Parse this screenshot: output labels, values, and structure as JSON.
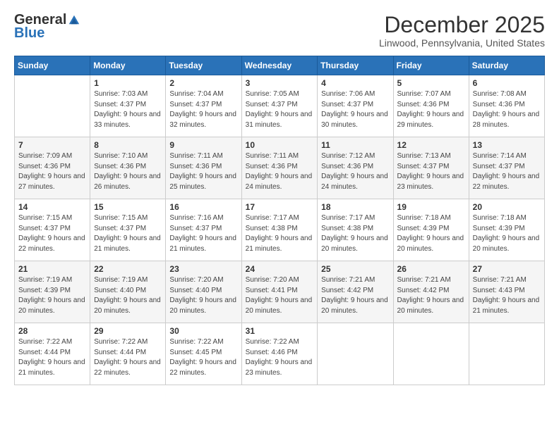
{
  "header": {
    "logo_general": "General",
    "logo_blue": "Blue",
    "month_title": "December 2025",
    "location": "Linwood, Pennsylvania, United States"
  },
  "days_of_week": [
    "Sunday",
    "Monday",
    "Tuesday",
    "Wednesday",
    "Thursday",
    "Friday",
    "Saturday"
  ],
  "weeks": [
    [
      {
        "day": "",
        "sunrise": "",
        "sunset": "",
        "daylight": ""
      },
      {
        "day": "1",
        "sunrise": "Sunrise: 7:03 AM",
        "sunset": "Sunset: 4:37 PM",
        "daylight": "Daylight: 9 hours and 33 minutes."
      },
      {
        "day": "2",
        "sunrise": "Sunrise: 7:04 AM",
        "sunset": "Sunset: 4:37 PM",
        "daylight": "Daylight: 9 hours and 32 minutes."
      },
      {
        "day": "3",
        "sunrise": "Sunrise: 7:05 AM",
        "sunset": "Sunset: 4:37 PM",
        "daylight": "Daylight: 9 hours and 31 minutes."
      },
      {
        "day": "4",
        "sunrise": "Sunrise: 7:06 AM",
        "sunset": "Sunset: 4:37 PM",
        "daylight": "Daylight: 9 hours and 30 minutes."
      },
      {
        "day": "5",
        "sunrise": "Sunrise: 7:07 AM",
        "sunset": "Sunset: 4:36 PM",
        "daylight": "Daylight: 9 hours and 29 minutes."
      },
      {
        "day": "6",
        "sunrise": "Sunrise: 7:08 AM",
        "sunset": "Sunset: 4:36 PM",
        "daylight": "Daylight: 9 hours and 28 minutes."
      }
    ],
    [
      {
        "day": "7",
        "sunrise": "Sunrise: 7:09 AM",
        "sunset": "Sunset: 4:36 PM",
        "daylight": "Daylight: 9 hours and 27 minutes."
      },
      {
        "day": "8",
        "sunrise": "Sunrise: 7:10 AM",
        "sunset": "Sunset: 4:36 PM",
        "daylight": "Daylight: 9 hours and 26 minutes."
      },
      {
        "day": "9",
        "sunrise": "Sunrise: 7:11 AM",
        "sunset": "Sunset: 4:36 PM",
        "daylight": "Daylight: 9 hours and 25 minutes."
      },
      {
        "day": "10",
        "sunrise": "Sunrise: 7:11 AM",
        "sunset": "Sunset: 4:36 PM",
        "daylight": "Daylight: 9 hours and 24 minutes."
      },
      {
        "day": "11",
        "sunrise": "Sunrise: 7:12 AM",
        "sunset": "Sunset: 4:36 PM",
        "daylight": "Daylight: 9 hours and 24 minutes."
      },
      {
        "day": "12",
        "sunrise": "Sunrise: 7:13 AM",
        "sunset": "Sunset: 4:37 PM",
        "daylight": "Daylight: 9 hours and 23 minutes."
      },
      {
        "day": "13",
        "sunrise": "Sunrise: 7:14 AM",
        "sunset": "Sunset: 4:37 PM",
        "daylight": "Daylight: 9 hours and 22 minutes."
      }
    ],
    [
      {
        "day": "14",
        "sunrise": "Sunrise: 7:15 AM",
        "sunset": "Sunset: 4:37 PM",
        "daylight": "Daylight: 9 hours and 22 minutes."
      },
      {
        "day": "15",
        "sunrise": "Sunrise: 7:15 AM",
        "sunset": "Sunset: 4:37 PM",
        "daylight": "Daylight: 9 hours and 21 minutes."
      },
      {
        "day": "16",
        "sunrise": "Sunrise: 7:16 AM",
        "sunset": "Sunset: 4:37 PM",
        "daylight": "Daylight: 9 hours and 21 minutes."
      },
      {
        "day": "17",
        "sunrise": "Sunrise: 7:17 AM",
        "sunset": "Sunset: 4:38 PM",
        "daylight": "Daylight: 9 hours and 21 minutes."
      },
      {
        "day": "18",
        "sunrise": "Sunrise: 7:17 AM",
        "sunset": "Sunset: 4:38 PM",
        "daylight": "Daylight: 9 hours and 20 minutes."
      },
      {
        "day": "19",
        "sunrise": "Sunrise: 7:18 AM",
        "sunset": "Sunset: 4:39 PM",
        "daylight": "Daylight: 9 hours and 20 minutes."
      },
      {
        "day": "20",
        "sunrise": "Sunrise: 7:18 AM",
        "sunset": "Sunset: 4:39 PM",
        "daylight": "Daylight: 9 hours and 20 minutes."
      }
    ],
    [
      {
        "day": "21",
        "sunrise": "Sunrise: 7:19 AM",
        "sunset": "Sunset: 4:39 PM",
        "daylight": "Daylight: 9 hours and 20 minutes."
      },
      {
        "day": "22",
        "sunrise": "Sunrise: 7:19 AM",
        "sunset": "Sunset: 4:40 PM",
        "daylight": "Daylight: 9 hours and 20 minutes."
      },
      {
        "day": "23",
        "sunrise": "Sunrise: 7:20 AM",
        "sunset": "Sunset: 4:40 PM",
        "daylight": "Daylight: 9 hours and 20 minutes."
      },
      {
        "day": "24",
        "sunrise": "Sunrise: 7:20 AM",
        "sunset": "Sunset: 4:41 PM",
        "daylight": "Daylight: 9 hours and 20 minutes."
      },
      {
        "day": "25",
        "sunrise": "Sunrise: 7:21 AM",
        "sunset": "Sunset: 4:42 PM",
        "daylight": "Daylight: 9 hours and 20 minutes."
      },
      {
        "day": "26",
        "sunrise": "Sunrise: 7:21 AM",
        "sunset": "Sunset: 4:42 PM",
        "daylight": "Daylight: 9 hours and 20 minutes."
      },
      {
        "day": "27",
        "sunrise": "Sunrise: 7:21 AM",
        "sunset": "Sunset: 4:43 PM",
        "daylight": "Daylight: 9 hours and 21 minutes."
      }
    ],
    [
      {
        "day": "28",
        "sunrise": "Sunrise: 7:22 AM",
        "sunset": "Sunset: 4:44 PM",
        "daylight": "Daylight: 9 hours and 21 minutes."
      },
      {
        "day": "29",
        "sunrise": "Sunrise: 7:22 AM",
        "sunset": "Sunset: 4:44 PM",
        "daylight": "Daylight: 9 hours and 22 minutes."
      },
      {
        "day": "30",
        "sunrise": "Sunrise: 7:22 AM",
        "sunset": "Sunset: 4:45 PM",
        "daylight": "Daylight: 9 hours and 22 minutes."
      },
      {
        "day": "31",
        "sunrise": "Sunrise: 7:22 AM",
        "sunset": "Sunset: 4:46 PM",
        "daylight": "Daylight: 9 hours and 23 minutes."
      },
      {
        "day": "",
        "sunrise": "",
        "sunset": "",
        "daylight": ""
      },
      {
        "day": "",
        "sunrise": "",
        "sunset": "",
        "daylight": ""
      },
      {
        "day": "",
        "sunrise": "",
        "sunset": "",
        "daylight": ""
      }
    ]
  ]
}
